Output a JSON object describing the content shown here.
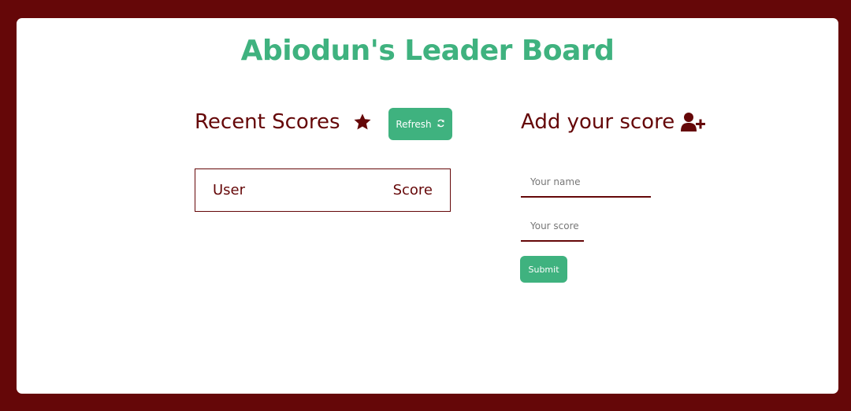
{
  "app": {
    "title": "Abiodun's Leader Board"
  },
  "recent_scores": {
    "heading": "Recent Scores",
    "heading_icon": "star-icon",
    "refresh_label": "Refresh",
    "refresh_icon": "refresh-icon",
    "table": {
      "columns": [
        "User",
        "Score"
      ],
      "rows": []
    }
  },
  "add_score": {
    "heading": "Add your score",
    "heading_icon": "user-plus-icon",
    "name_placeholder": "Your name",
    "score_placeholder": "Your score",
    "submit_label": "Submit"
  },
  "colors": {
    "accent": "#3fb27f",
    "primary": "#650708",
    "background": "#ffffff"
  }
}
